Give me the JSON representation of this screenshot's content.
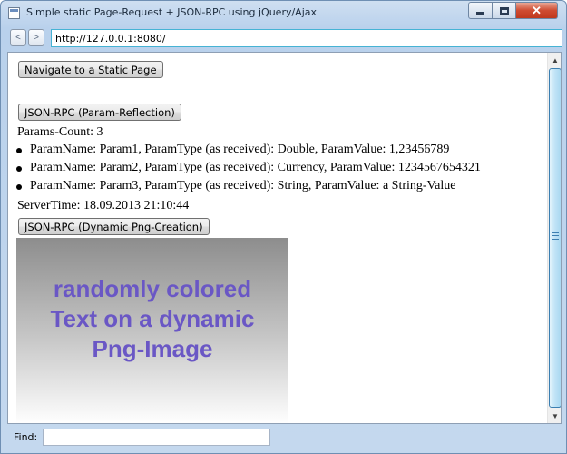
{
  "window": {
    "title": "Simple static Page-Request + JSON-RPC using jQuery/Ajax",
    "controls": {
      "minimize": "",
      "maximize": "",
      "close": "✕"
    }
  },
  "addressbar": {
    "back": "<",
    "forward": ">",
    "url": "http://127.0.0.1:8080/"
  },
  "page": {
    "navigate_button": "Navigate to a Static Page",
    "reflect_button": "JSON-RPC (Param-Reflection)",
    "params_count": "Params-Count: 3",
    "params": [
      {
        "text": "ParamName: Param1, ParamType (as received): Double, ParamValue: 1,23456789"
      },
      {
        "text": "ParamName: Param2, ParamType (as received): Currency, ParamValue: 1234567654321"
      },
      {
        "text": "ParamName: Param3, ParamType (as received): String, ParamValue: a String-Value"
      }
    ],
    "server_time": "ServerTime: 18.09.2013 21:10:44",
    "png_button": "JSON-RPC (Dynamic Png-Creation)",
    "png_image": {
      "lines": [
        "randomly colored",
        "Text on a dynamic",
        "Png-Image"
      ],
      "text_color": "#6a57c5"
    }
  },
  "scrollbar": {
    "up": "▲",
    "down": "▼"
  },
  "findbar": {
    "label": "Find:",
    "value": ""
  }
}
